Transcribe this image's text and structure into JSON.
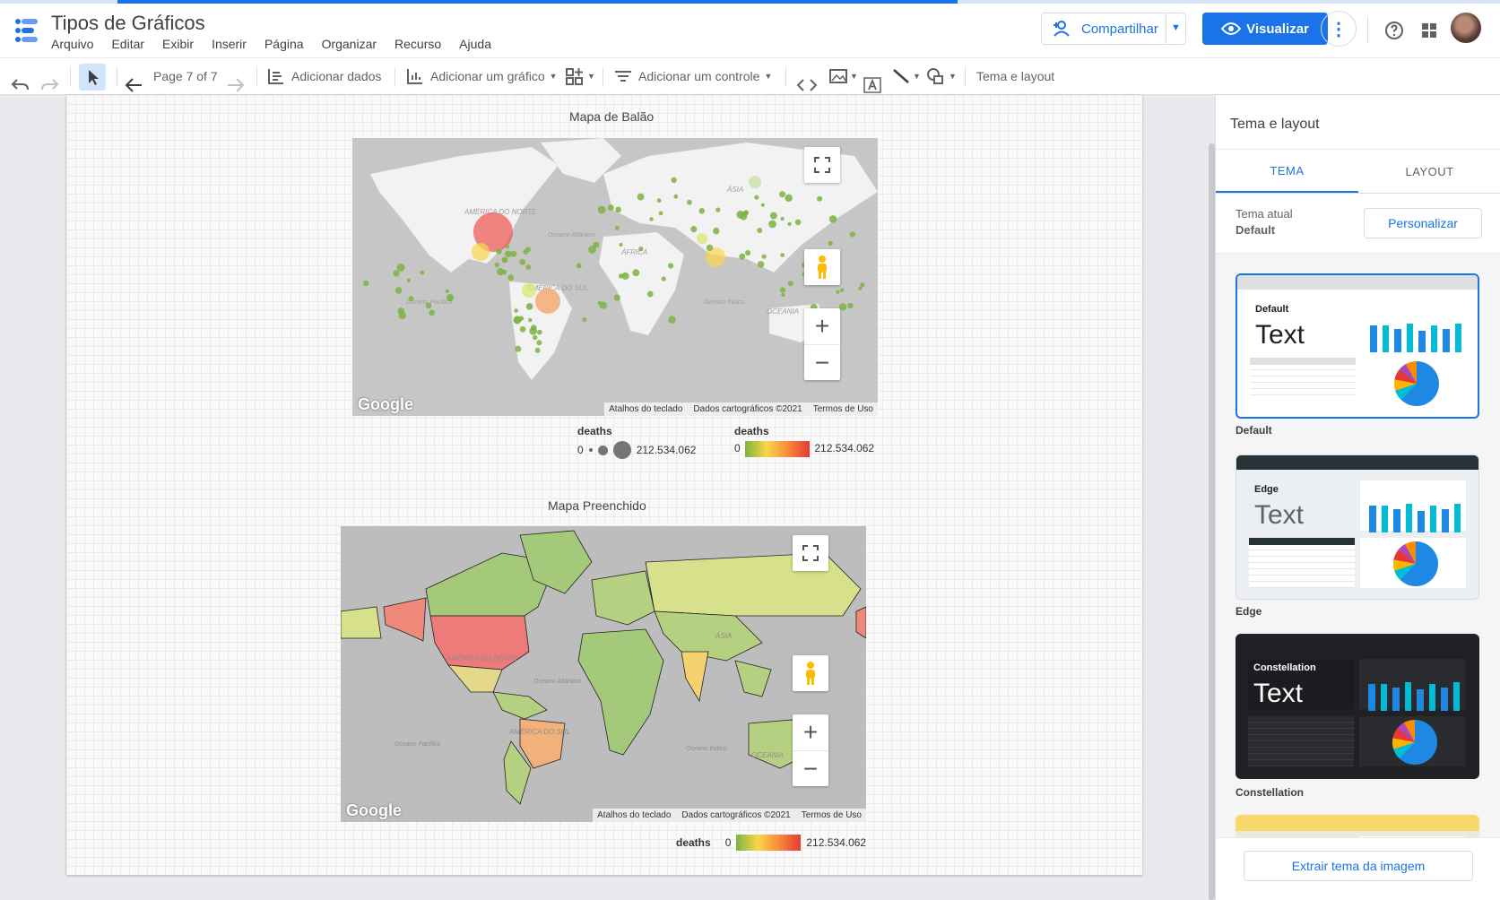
{
  "app": {
    "title": "Tipos de Gráficos",
    "menu": [
      "Arquivo",
      "Editar",
      "Exibir",
      "Inserir",
      "Página",
      "Organizar",
      "Recurso",
      "Ajuda"
    ],
    "progress_fraction": 0.56
  },
  "header": {
    "share_label": "Compartilhar",
    "view_label": "Visualizar",
    "accent_color": "#1a73e8"
  },
  "toolbar": {
    "page_indicator": "Page 7 of 7",
    "add_data": "Adicionar dados",
    "add_chart": "Adicionar um gráfico",
    "add_control": "Adicionar um controle",
    "theme_layout": "Tema e layout"
  },
  "charts": {
    "bubble_map": {
      "title": "Mapa de Balão",
      "labels": {
        "north_america": "AMÉRICA DO NORTE",
        "south_america": "AMÉRICA DO SUL",
        "asia": "ÁSIA",
        "africa": "ÁFRICA",
        "oceania": "OCEANIA",
        "atlantic": "Oceano Atlântico",
        "pacific": "Oceano Pacífico",
        "indian": "Oceano Índico"
      },
      "google_logo": "Google",
      "footer": {
        "shortcuts": "Atalhos do teclado",
        "map_data": "Dados cartográficos ©2021",
        "terms": "Termos de Uso"
      },
      "legend_size": {
        "title": "deaths",
        "min": "0",
        "max": "212.534.062"
      },
      "legend_color": {
        "title": "deaths",
        "min": "0",
        "max": "212.534.062"
      }
    },
    "filled_map": {
      "title": "Mapa Preenchido",
      "labels": {
        "north_america": "AMÉRICA DO NORTE",
        "south_america": "AMÉRICA DO SUL",
        "asia": "ÁSIA",
        "oceania": "OCEANIA",
        "atlantic": "Oceano Atlântico",
        "pacific": "Oceano Pacífico",
        "indian": "Oceano Índico"
      },
      "google_logo": "Google",
      "footer": {
        "shortcuts": "Atalhos do teclado",
        "map_data": "Dados cartográficos ©2021",
        "terms": "Termos de Uso"
      },
      "legend": {
        "title": "deaths",
        "min": "0",
        "max": "212.534.062"
      }
    }
  },
  "panel": {
    "title": "Tema e layout",
    "tabs": {
      "theme": "TEMA",
      "layout": "LAYOUT"
    },
    "current_label": "Tema atual",
    "current_value": "Default",
    "customize": "Personalizar",
    "themes": [
      {
        "name": "Default",
        "card_label": "Default",
        "sample": "Text"
      },
      {
        "name": "Edge",
        "card_label": "Edge",
        "sample": "Text"
      },
      {
        "name": "Constellation",
        "card_label": "Constellation",
        "sample": "Text"
      }
    ],
    "extract": "Extrair tema da imagem"
  }
}
